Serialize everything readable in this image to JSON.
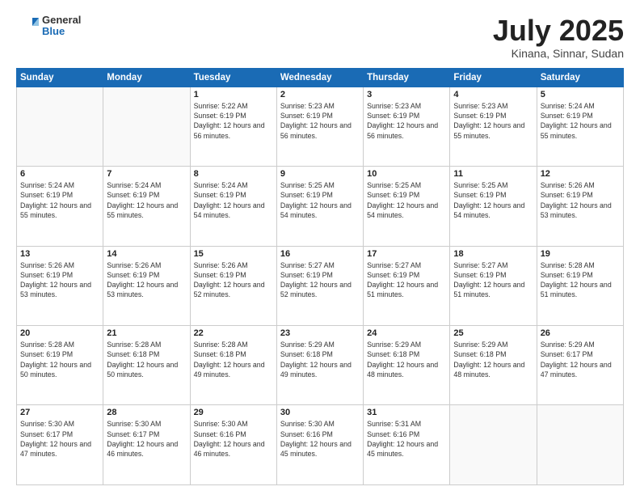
{
  "header": {
    "logo_general": "General",
    "logo_blue": "Blue",
    "month_title": "July 2025",
    "location": "Kinana, Sinnar, Sudan"
  },
  "days_of_week": [
    "Sunday",
    "Monday",
    "Tuesday",
    "Wednesday",
    "Thursday",
    "Friday",
    "Saturday"
  ],
  "weeks": [
    [
      {
        "day": "",
        "info": ""
      },
      {
        "day": "",
        "info": ""
      },
      {
        "day": "1",
        "info": "Sunrise: 5:22 AM\nSunset: 6:19 PM\nDaylight: 12 hours and 56 minutes."
      },
      {
        "day": "2",
        "info": "Sunrise: 5:23 AM\nSunset: 6:19 PM\nDaylight: 12 hours and 56 minutes."
      },
      {
        "day": "3",
        "info": "Sunrise: 5:23 AM\nSunset: 6:19 PM\nDaylight: 12 hours and 56 minutes."
      },
      {
        "day": "4",
        "info": "Sunrise: 5:23 AM\nSunset: 6:19 PM\nDaylight: 12 hours and 55 minutes."
      },
      {
        "day": "5",
        "info": "Sunrise: 5:24 AM\nSunset: 6:19 PM\nDaylight: 12 hours and 55 minutes."
      }
    ],
    [
      {
        "day": "6",
        "info": "Sunrise: 5:24 AM\nSunset: 6:19 PM\nDaylight: 12 hours and 55 minutes."
      },
      {
        "day": "7",
        "info": "Sunrise: 5:24 AM\nSunset: 6:19 PM\nDaylight: 12 hours and 55 minutes."
      },
      {
        "day": "8",
        "info": "Sunrise: 5:24 AM\nSunset: 6:19 PM\nDaylight: 12 hours and 54 minutes."
      },
      {
        "day": "9",
        "info": "Sunrise: 5:25 AM\nSunset: 6:19 PM\nDaylight: 12 hours and 54 minutes."
      },
      {
        "day": "10",
        "info": "Sunrise: 5:25 AM\nSunset: 6:19 PM\nDaylight: 12 hours and 54 minutes."
      },
      {
        "day": "11",
        "info": "Sunrise: 5:25 AM\nSunset: 6:19 PM\nDaylight: 12 hours and 54 minutes."
      },
      {
        "day": "12",
        "info": "Sunrise: 5:26 AM\nSunset: 6:19 PM\nDaylight: 12 hours and 53 minutes."
      }
    ],
    [
      {
        "day": "13",
        "info": "Sunrise: 5:26 AM\nSunset: 6:19 PM\nDaylight: 12 hours and 53 minutes."
      },
      {
        "day": "14",
        "info": "Sunrise: 5:26 AM\nSunset: 6:19 PM\nDaylight: 12 hours and 53 minutes."
      },
      {
        "day": "15",
        "info": "Sunrise: 5:26 AM\nSunset: 6:19 PM\nDaylight: 12 hours and 52 minutes."
      },
      {
        "day": "16",
        "info": "Sunrise: 5:27 AM\nSunset: 6:19 PM\nDaylight: 12 hours and 52 minutes."
      },
      {
        "day": "17",
        "info": "Sunrise: 5:27 AM\nSunset: 6:19 PM\nDaylight: 12 hours and 51 minutes."
      },
      {
        "day": "18",
        "info": "Sunrise: 5:27 AM\nSunset: 6:19 PM\nDaylight: 12 hours and 51 minutes."
      },
      {
        "day": "19",
        "info": "Sunrise: 5:28 AM\nSunset: 6:19 PM\nDaylight: 12 hours and 51 minutes."
      }
    ],
    [
      {
        "day": "20",
        "info": "Sunrise: 5:28 AM\nSunset: 6:19 PM\nDaylight: 12 hours and 50 minutes."
      },
      {
        "day": "21",
        "info": "Sunrise: 5:28 AM\nSunset: 6:18 PM\nDaylight: 12 hours and 50 minutes."
      },
      {
        "day": "22",
        "info": "Sunrise: 5:28 AM\nSunset: 6:18 PM\nDaylight: 12 hours and 49 minutes."
      },
      {
        "day": "23",
        "info": "Sunrise: 5:29 AM\nSunset: 6:18 PM\nDaylight: 12 hours and 49 minutes."
      },
      {
        "day": "24",
        "info": "Sunrise: 5:29 AM\nSunset: 6:18 PM\nDaylight: 12 hours and 48 minutes."
      },
      {
        "day": "25",
        "info": "Sunrise: 5:29 AM\nSunset: 6:18 PM\nDaylight: 12 hours and 48 minutes."
      },
      {
        "day": "26",
        "info": "Sunrise: 5:29 AM\nSunset: 6:17 PM\nDaylight: 12 hours and 47 minutes."
      }
    ],
    [
      {
        "day": "27",
        "info": "Sunrise: 5:30 AM\nSunset: 6:17 PM\nDaylight: 12 hours and 47 minutes."
      },
      {
        "day": "28",
        "info": "Sunrise: 5:30 AM\nSunset: 6:17 PM\nDaylight: 12 hours and 46 minutes."
      },
      {
        "day": "29",
        "info": "Sunrise: 5:30 AM\nSunset: 6:16 PM\nDaylight: 12 hours and 46 minutes."
      },
      {
        "day": "30",
        "info": "Sunrise: 5:30 AM\nSunset: 6:16 PM\nDaylight: 12 hours and 45 minutes."
      },
      {
        "day": "31",
        "info": "Sunrise: 5:31 AM\nSunset: 6:16 PM\nDaylight: 12 hours and 45 minutes."
      },
      {
        "day": "",
        "info": ""
      },
      {
        "day": "",
        "info": ""
      }
    ]
  ]
}
